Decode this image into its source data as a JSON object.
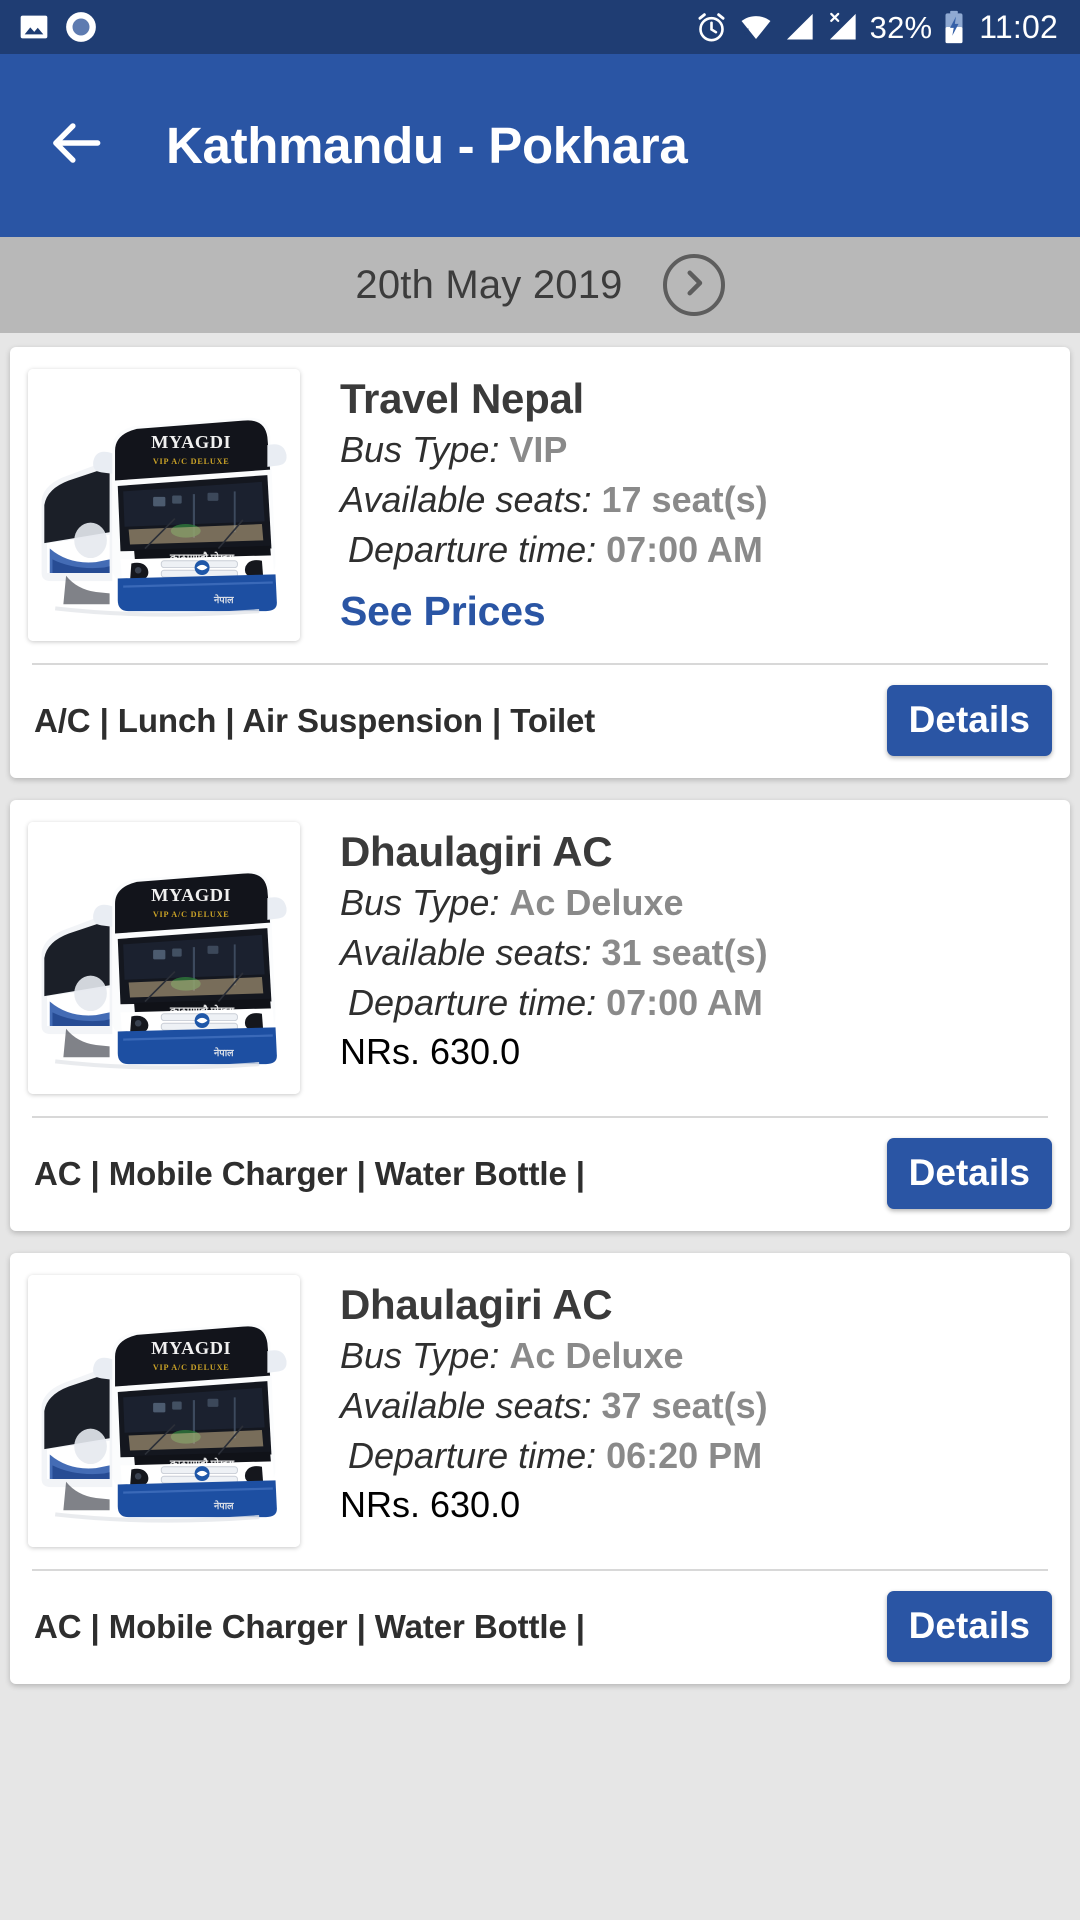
{
  "status_bar": {
    "icons_left": [
      "photo-icon",
      "record-icon"
    ],
    "icons_right": [
      "alarm-icon",
      "wifi-icon",
      "signal-icon",
      "signal-no-sim-icon"
    ],
    "battery_percent": "32%",
    "battery_icon": "battery-charging-icon",
    "time": "11:02"
  },
  "app_bar": {
    "back_icon": "back-arrow-icon",
    "title": "Kathmandu - Pokhara"
  },
  "date_bar": {
    "date": "20th May 2019",
    "next_icon": "chevron-right-icon"
  },
  "labels": {
    "bus_type": "Bus Type:",
    "available_seats": "Available seats:",
    "departure_time": "Departure time:",
    "currency": "NRs.",
    "see_prices": "See Prices",
    "details": "Details"
  },
  "colors": {
    "status_bar": "#1f3d73",
    "app_bar": "#2a55a4",
    "accent": "#2a55a4",
    "date_bar": "#b8b8b8",
    "page_background": "#e6e6e6",
    "card": "#ffffff",
    "value_text": "#8a8a8a"
  },
  "buses": [
    {
      "name": "Travel Nepal",
      "bus_type": "VIP",
      "seats": "17 seat(s)",
      "departure": "07:00 AM",
      "price": null,
      "has_see_prices": true,
      "amenities": "A/C  |  Lunch  |  Air Suspension  |  Toilet",
      "details_label": "Details",
      "image_alt": "MYAGDI KORALA"
    },
    {
      "name": "Dhaulagiri AC",
      "bus_type": "Ac Deluxe",
      "seats": "31 seat(s)",
      "departure": "07:00 AM",
      "price": "630.0",
      "has_see_prices": false,
      "amenities": "AC  |  Mobile Charger  |  Water Bottle  |",
      "details_label": "Details",
      "image_alt": "MYAGDI KORALA"
    },
    {
      "name": "Dhaulagiri AC",
      "bus_type": "Ac Deluxe",
      "seats": "37 seat(s)",
      "departure": "06:20 PM",
      "price": "630.0",
      "has_see_prices": false,
      "amenities": "AC  |  Mobile Charger  |  Water Bottle  |",
      "details_label": "Details",
      "image_alt": "MYAGDI KORALA"
    }
  ]
}
